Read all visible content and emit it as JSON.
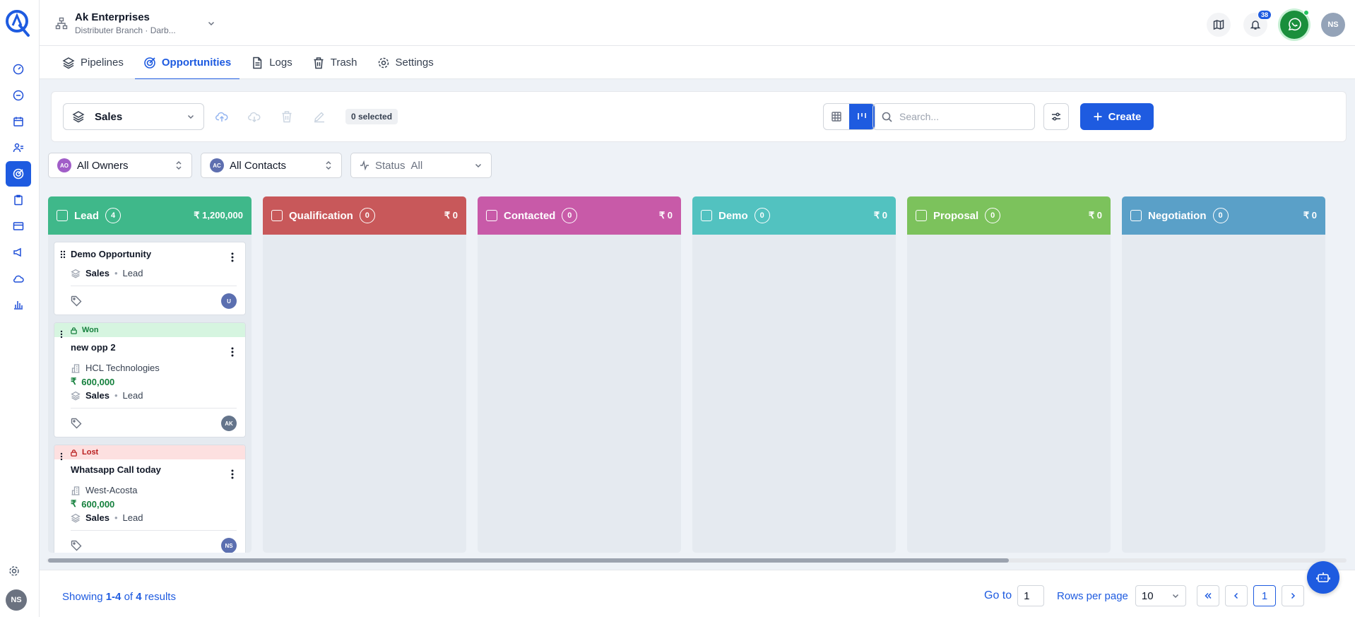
{
  "org": {
    "name": "Ak Enterprises",
    "subtitle": "Distributer Branch · Darb..."
  },
  "header": {
    "notification_count": "38",
    "user_initials": "NS"
  },
  "tabs": [
    {
      "label": "Pipelines",
      "icon": "layers-icon"
    },
    {
      "label": "Opportunities",
      "icon": "target-icon"
    },
    {
      "label": "Logs",
      "icon": "document-icon"
    },
    {
      "label": "Trash",
      "icon": "trash-icon"
    },
    {
      "label": "Settings",
      "icon": "gear-icon"
    }
  ],
  "toolbar": {
    "pipeline": "Sales",
    "selected_label": "0 selected",
    "search_placeholder": "Search...",
    "create_label": "Create"
  },
  "filters": {
    "owners": {
      "initials": "AO",
      "label": "All Owners"
    },
    "contacts": {
      "initials": "AC",
      "label": "All Contacts"
    },
    "status": {
      "label": "Status",
      "value": "All"
    }
  },
  "columns": [
    {
      "name": "Lead",
      "count": "4",
      "amount": "₹ 1,200,000",
      "color": "#3fb88a"
    },
    {
      "name": "Qualification",
      "count": "0",
      "amount": "₹ 0",
      "color": "#c8585a"
    },
    {
      "name": "Contacted",
      "count": "0",
      "amount": "₹ 0",
      "color": "#c85aa8"
    },
    {
      "name": "Demo",
      "count": "0",
      "amount": "₹ 0",
      "color": "#52c2c0"
    },
    {
      "name": "Proposal",
      "count": "0",
      "amount": "₹ 0",
      "color": "#7cc25c"
    },
    {
      "name": "Negotiation",
      "count": "0",
      "amount": "₹ 0",
      "color": "#5aa0c8"
    }
  ],
  "cards": [
    {
      "title": "Demo Opportunity",
      "pipeline": "Sales",
      "stage": "Lead",
      "owner": "U"
    },
    {
      "status": "Won",
      "title": "new opp 2",
      "company": "HCL Technologies",
      "amount": "600,000",
      "pipeline": "Sales",
      "stage": "Lead",
      "owner": "AK"
    },
    {
      "status": "Lost",
      "title": "Whatsapp Call today",
      "company": "West-Acosta",
      "amount": "600,000",
      "pipeline": "Sales",
      "stage": "Lead",
      "owner": "NS"
    }
  ],
  "pagination": {
    "showing_prefix": "Showing",
    "range": "1-4",
    "of": "of",
    "total": "4",
    "suffix": "results",
    "goto_label": "Go to",
    "goto_value": "1",
    "rows_label": "Rows per page",
    "rows_value": "10",
    "current_page": "1"
  },
  "sidebar": {
    "user_initials": "NS"
  },
  "colors": {
    "accent": "#1e5be0",
    "won": "#15803d",
    "lost": "#b91c1c"
  }
}
